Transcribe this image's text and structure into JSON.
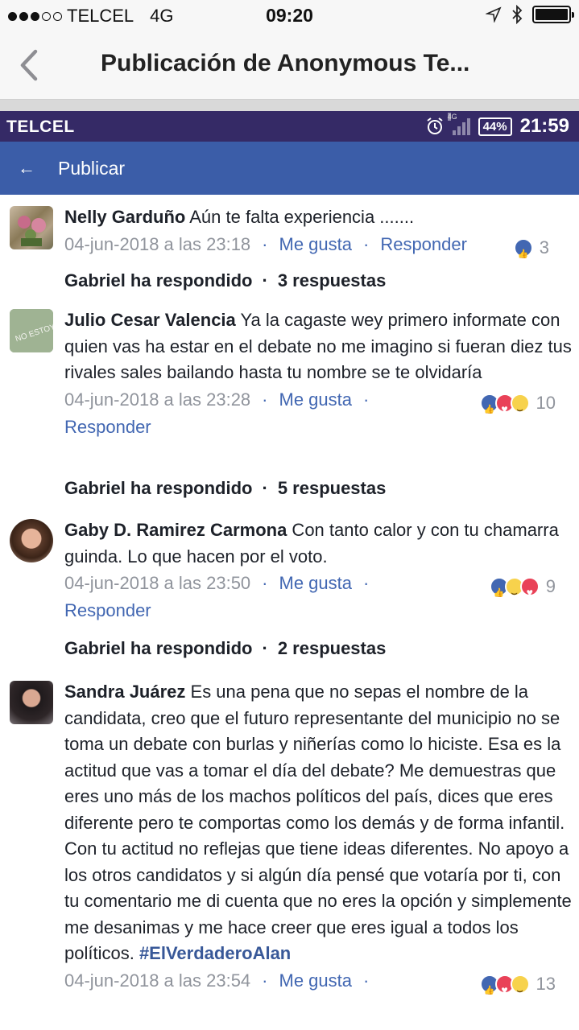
{
  "ios_status": {
    "carrier": "TELCEL",
    "network": "4G",
    "time": "09:20"
  },
  "nav": {
    "title": "Publicación de Anonymous Te..."
  },
  "android_status": {
    "carrier": "TELCEL",
    "network": "4G",
    "battery": "44%",
    "time": "21:59"
  },
  "header": {
    "label": "Publicar"
  },
  "actions": {
    "like": "Me gusta",
    "reply": "Responder",
    "dot": "·"
  },
  "comments": [
    {
      "author": "Nelly Garduño",
      "text": " Aún te falta experiencia .......",
      "timestamp": "04-jun-2018 a las 23:18",
      "reactions": [
        "like"
      ],
      "count": "3",
      "replies": {
        "who": "Gabriel ha respondido",
        "count": "3 respuestas"
      }
    },
    {
      "author": "Julio Cesar Valencia",
      "text": " Ya la cagaste wey primero informate con quien vas ha estar en el debate no me imagino si fueran diez tus rivales sales bailando hasta tu nombre se te olvidaría",
      "timestamp": "04-jun-2018 a las 23:28",
      "avatar_text": "NO ESTOY",
      "reactions": [
        "like",
        "love",
        "haha"
      ],
      "count": "10",
      "replies": {
        "who": "Gabriel ha respondido",
        "count": "5 respuestas"
      }
    },
    {
      "author": "Gaby D. Ramirez Carmona",
      "text": " Con tanto calor y con tu chamarra guinda. Lo que hacen por el voto.",
      "timestamp": "04-jun-2018 a las 23:50",
      "reactions": [
        "like",
        "haha",
        "love"
      ],
      "count": "9",
      "replies": {
        "who": "Gabriel ha respondido",
        "count": "2 respuestas"
      }
    },
    {
      "author": "Sandra Juárez",
      "text": " Es una pena que no sepas el nombre de la candidata, creo que el futuro representante del municipio no se toma un debate con burlas y niñerías como lo hiciste. Esa es la actitud que vas a tomar el día del debate? Me demuestras que eres uno más de los machos políticos del país, dices que eres diferente pero te comportas como los demás y de forma infantil. Con tu actitud no reflejas que tiene ideas diferentes. No apoyo a los otros candidatos y si algún día pensé que votaría por ti, con tu comentario me di cuenta que no eres la opción y simplemente me desanimas y me hace creer que eres igual a todos los políticos. ",
      "hashtag": "#ElVerdaderoAlan",
      "timestamp": "04-jun-2018 a las 23:54",
      "reactions": [
        "like",
        "love",
        "haha"
      ],
      "count": "13"
    }
  ]
}
